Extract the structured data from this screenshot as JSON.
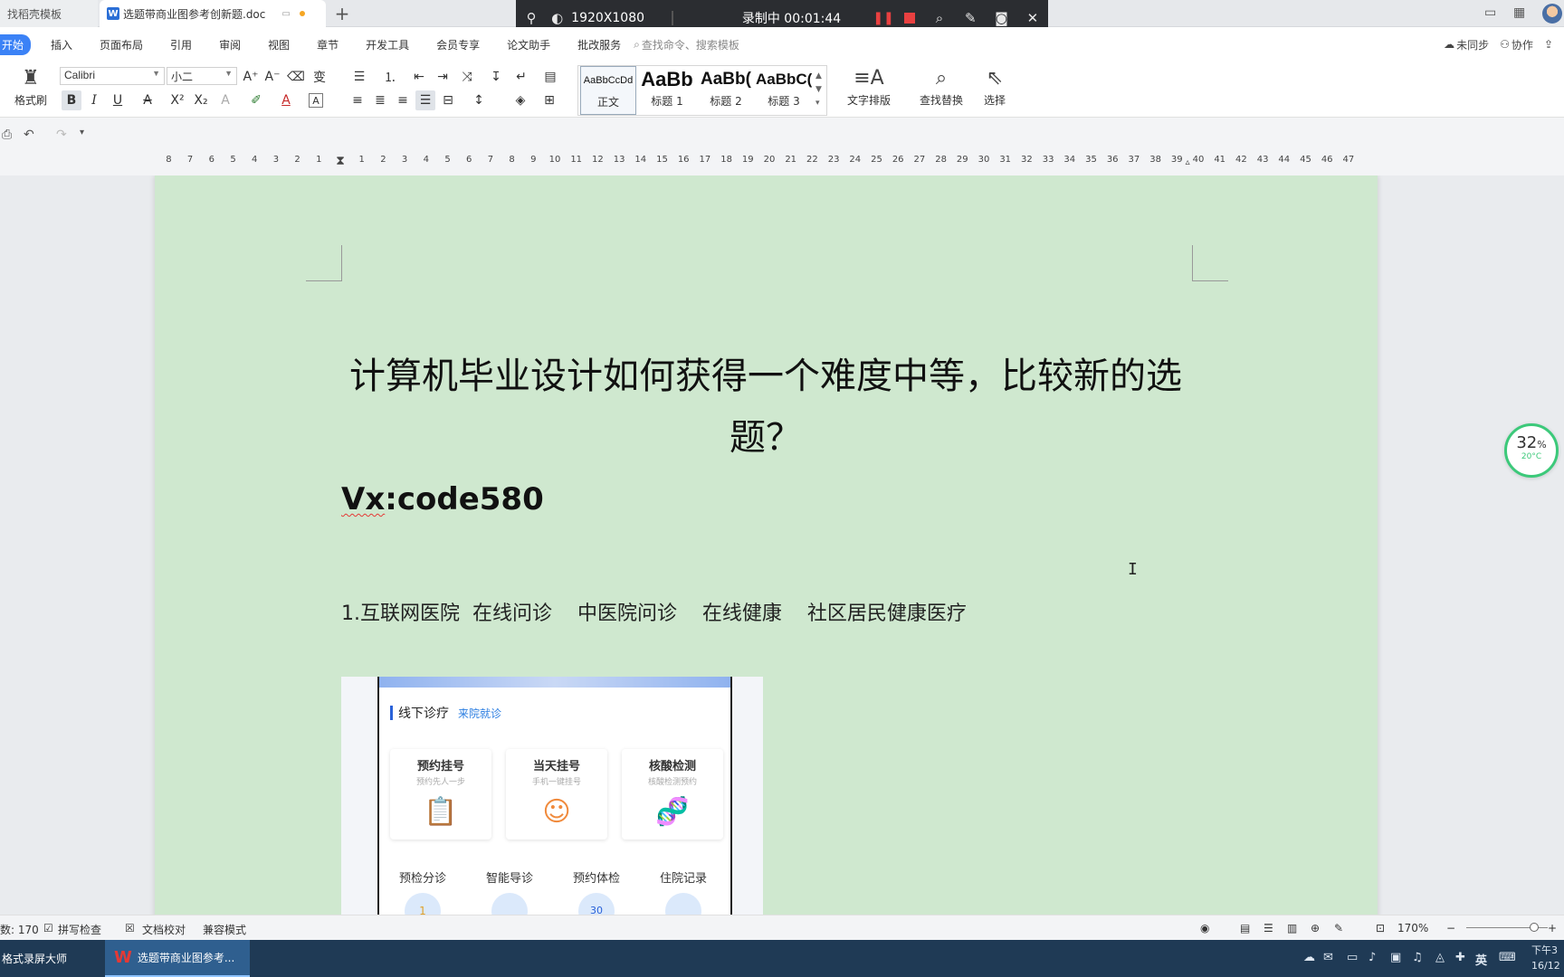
{
  "titlebar": {
    "tabs": [
      {
        "label": "找稻壳模板"
      },
      {
        "label": "选题带商业图参考创新题.doc"
      }
    ],
    "new_tab": "+"
  },
  "recorder": {
    "resolution": "1920X1080",
    "status": "录制中 00:01:44"
  },
  "menu": {
    "items": [
      "开始",
      "插入",
      "页面布局",
      "引用",
      "审阅",
      "视图",
      "章节",
      "开发工具",
      "会员专享",
      "论文助手",
      "批改服务"
    ],
    "search_placeholder": "查找命令、搜索模板",
    "right": {
      "sync": "未同步",
      "collab": "协作"
    }
  },
  "ribbon": {
    "format_painter": "格式刷",
    "font_name": "Calibri",
    "font_size": "小二",
    "styles": [
      {
        "preview": "AaBbCcDd",
        "label": "正文"
      },
      {
        "preview": "AaBb",
        "label": "标题 1"
      },
      {
        "preview": "AaBb(",
        "label": "标题 2"
      },
      {
        "preview": "AaBbC(",
        "label": "标题 3"
      }
    ],
    "text_layout": "文字排版",
    "find_replace": "查找替换",
    "select": "选择"
  },
  "ruler": {
    "left_numbers": [
      "8",
      "7",
      "6",
      "5",
      "4",
      "3",
      "2",
      "1"
    ],
    "right_numbers": [
      "1",
      "2",
      "3",
      "4",
      "5",
      "6",
      "7",
      "8",
      "9",
      "10",
      "11",
      "12",
      "13",
      "14",
      "15",
      "16",
      "17",
      "18",
      "19",
      "20",
      "21",
      "22",
      "23",
      "24",
      "25",
      "26",
      "27",
      "28",
      "29",
      "30",
      "31",
      "32",
      "33",
      "34",
      "35",
      "36",
      "37",
      "38",
      "39",
      "40",
      "41",
      "42",
      "43",
      "44",
      "45",
      "46",
      "47"
    ]
  },
  "document": {
    "title_line1": "计算机毕业设计如何获得一个难度中等，比较新的选",
    "title_line2": "题？",
    "contact": "Vx:code580",
    "contact_prefix": "Vx",
    "contact_suffix": ":code580",
    "item1_num": "1.",
    "item1_text": "互联网医院  在线问诊    中医院问诊    在线健康    社区居民健康医疗"
  },
  "embedded_app": {
    "section_title": "线下诊疗",
    "section_sub": "来院就诊",
    "cards": [
      {
        "title": "预约挂号",
        "sub": "预约先人一步"
      },
      {
        "title": "当天挂号",
        "sub": "手机一键挂号"
      },
      {
        "title": "核酸检测",
        "sub": "核酸检测预约"
      }
    ],
    "grid": [
      "预检分诊",
      "智能导诊",
      "预约体检",
      "住院记录"
    ],
    "grid_badges": [
      "1",
      "",
      "30",
      ""
    ]
  },
  "widget": {
    "percent": "32",
    "unit": "%",
    "temp": "20°C"
  },
  "statusbar": {
    "word_count": "数: 170",
    "spell_check": "拼写检查",
    "doc_proof": "文档校对",
    "compat_mode": "兼容模式",
    "zoom": "170%"
  },
  "taskbar": {
    "app1": "格式录屏大师",
    "app2": "选题带商业图参考...",
    "ime": "英",
    "clock_time": "下午3",
    "clock_date": "16/12"
  },
  "colors": {
    "page_bg": "#cfe8cf",
    "accent": "#3b82f6",
    "recorder_bg": "#2b2d31",
    "taskbar_bg": "#1f3a55"
  }
}
